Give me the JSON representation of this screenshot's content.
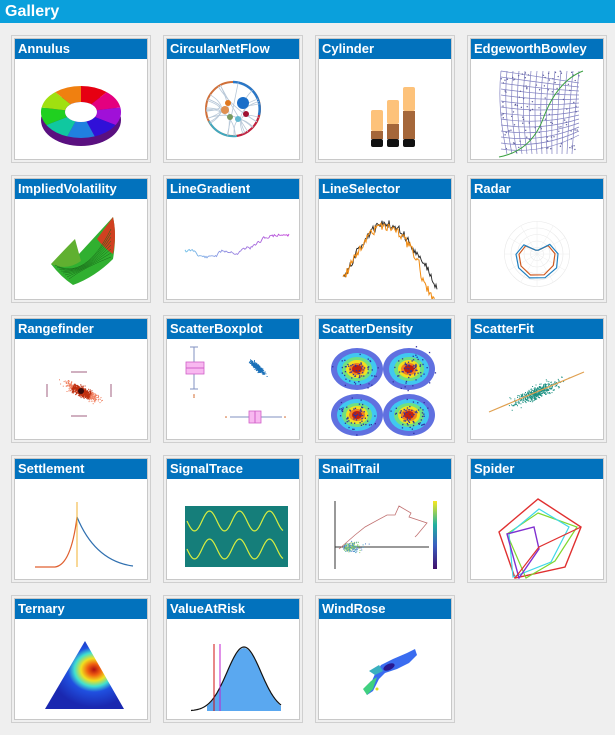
{
  "window": {
    "title": "Gallery"
  },
  "gallery": {
    "items": [
      {
        "label": "Annulus",
        "icon": "annulus-chart-icon"
      },
      {
        "label": "CircularNetFlow",
        "icon": "circular-net-flow-icon"
      },
      {
        "label": "Cylinder",
        "icon": "cylinder-bar-chart-icon"
      },
      {
        "label": "EdgeworthBowley",
        "icon": "edgeworth-bowley-icon"
      },
      {
        "label": "ImpliedVolatility",
        "icon": "implied-volatility-surface-icon"
      },
      {
        "label": "LineGradient",
        "icon": "line-gradient-icon"
      },
      {
        "label": "LineSelector",
        "icon": "line-selector-icon"
      },
      {
        "label": "Radar",
        "icon": "radar-chart-icon"
      },
      {
        "label": "Rangefinder",
        "icon": "rangefinder-icon"
      },
      {
        "label": "ScatterBoxplot",
        "icon": "scatter-boxplot-icon"
      },
      {
        "label": "ScatterDensity",
        "icon": "scatter-density-icon"
      },
      {
        "label": "ScatterFit",
        "icon": "scatter-fit-icon"
      },
      {
        "label": "Settlement",
        "icon": "settlement-icon"
      },
      {
        "label": "SignalTrace",
        "icon": "signal-trace-icon"
      },
      {
        "label": "SnailTrail",
        "icon": "snail-trail-icon"
      },
      {
        "label": "Spider",
        "icon": "spider-chart-icon"
      },
      {
        "label": "Ternary",
        "icon": "ternary-plot-icon"
      },
      {
        "label": "ValueAtRisk",
        "icon": "value-at-risk-icon"
      },
      {
        "label": "WindRose",
        "icon": "wind-rose-icon"
      }
    ]
  }
}
